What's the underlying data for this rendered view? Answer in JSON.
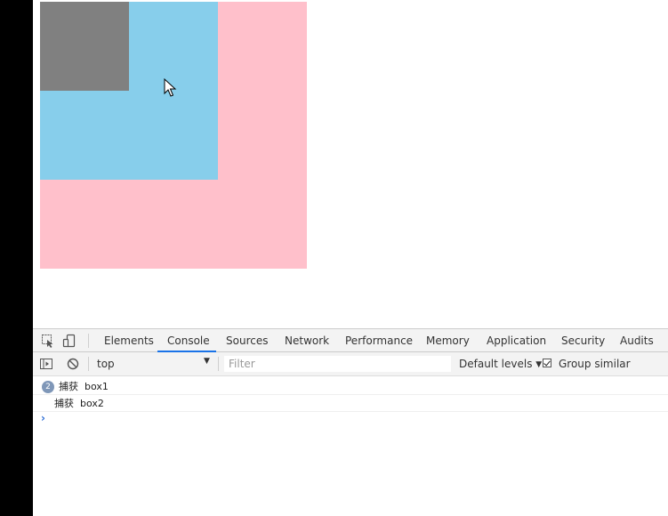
{
  "page": {
    "colors": {
      "outer_box": "#ffc0cb",
      "middle_box": "#87ceeb",
      "inner_box": "#808080"
    }
  },
  "devtools": {
    "tabs": [
      {
        "label": "Elements"
      },
      {
        "label": "Console",
        "active": true
      },
      {
        "label": "Sources"
      },
      {
        "label": "Network"
      },
      {
        "label": "Performance"
      },
      {
        "label": "Memory"
      },
      {
        "label": "Application"
      },
      {
        "label": "Security"
      },
      {
        "label": "Audits"
      }
    ],
    "toolbar": {
      "context": "top",
      "filter_placeholder": "Filter",
      "levels": "Default levels",
      "group_similar_label": "Group similar",
      "group_similar_checked": true
    },
    "console": {
      "messages": [
        {
          "count": "2",
          "text": "捕获  box1"
        },
        {
          "text": "捕获  box2"
        }
      ],
      "prompt": "›"
    }
  }
}
